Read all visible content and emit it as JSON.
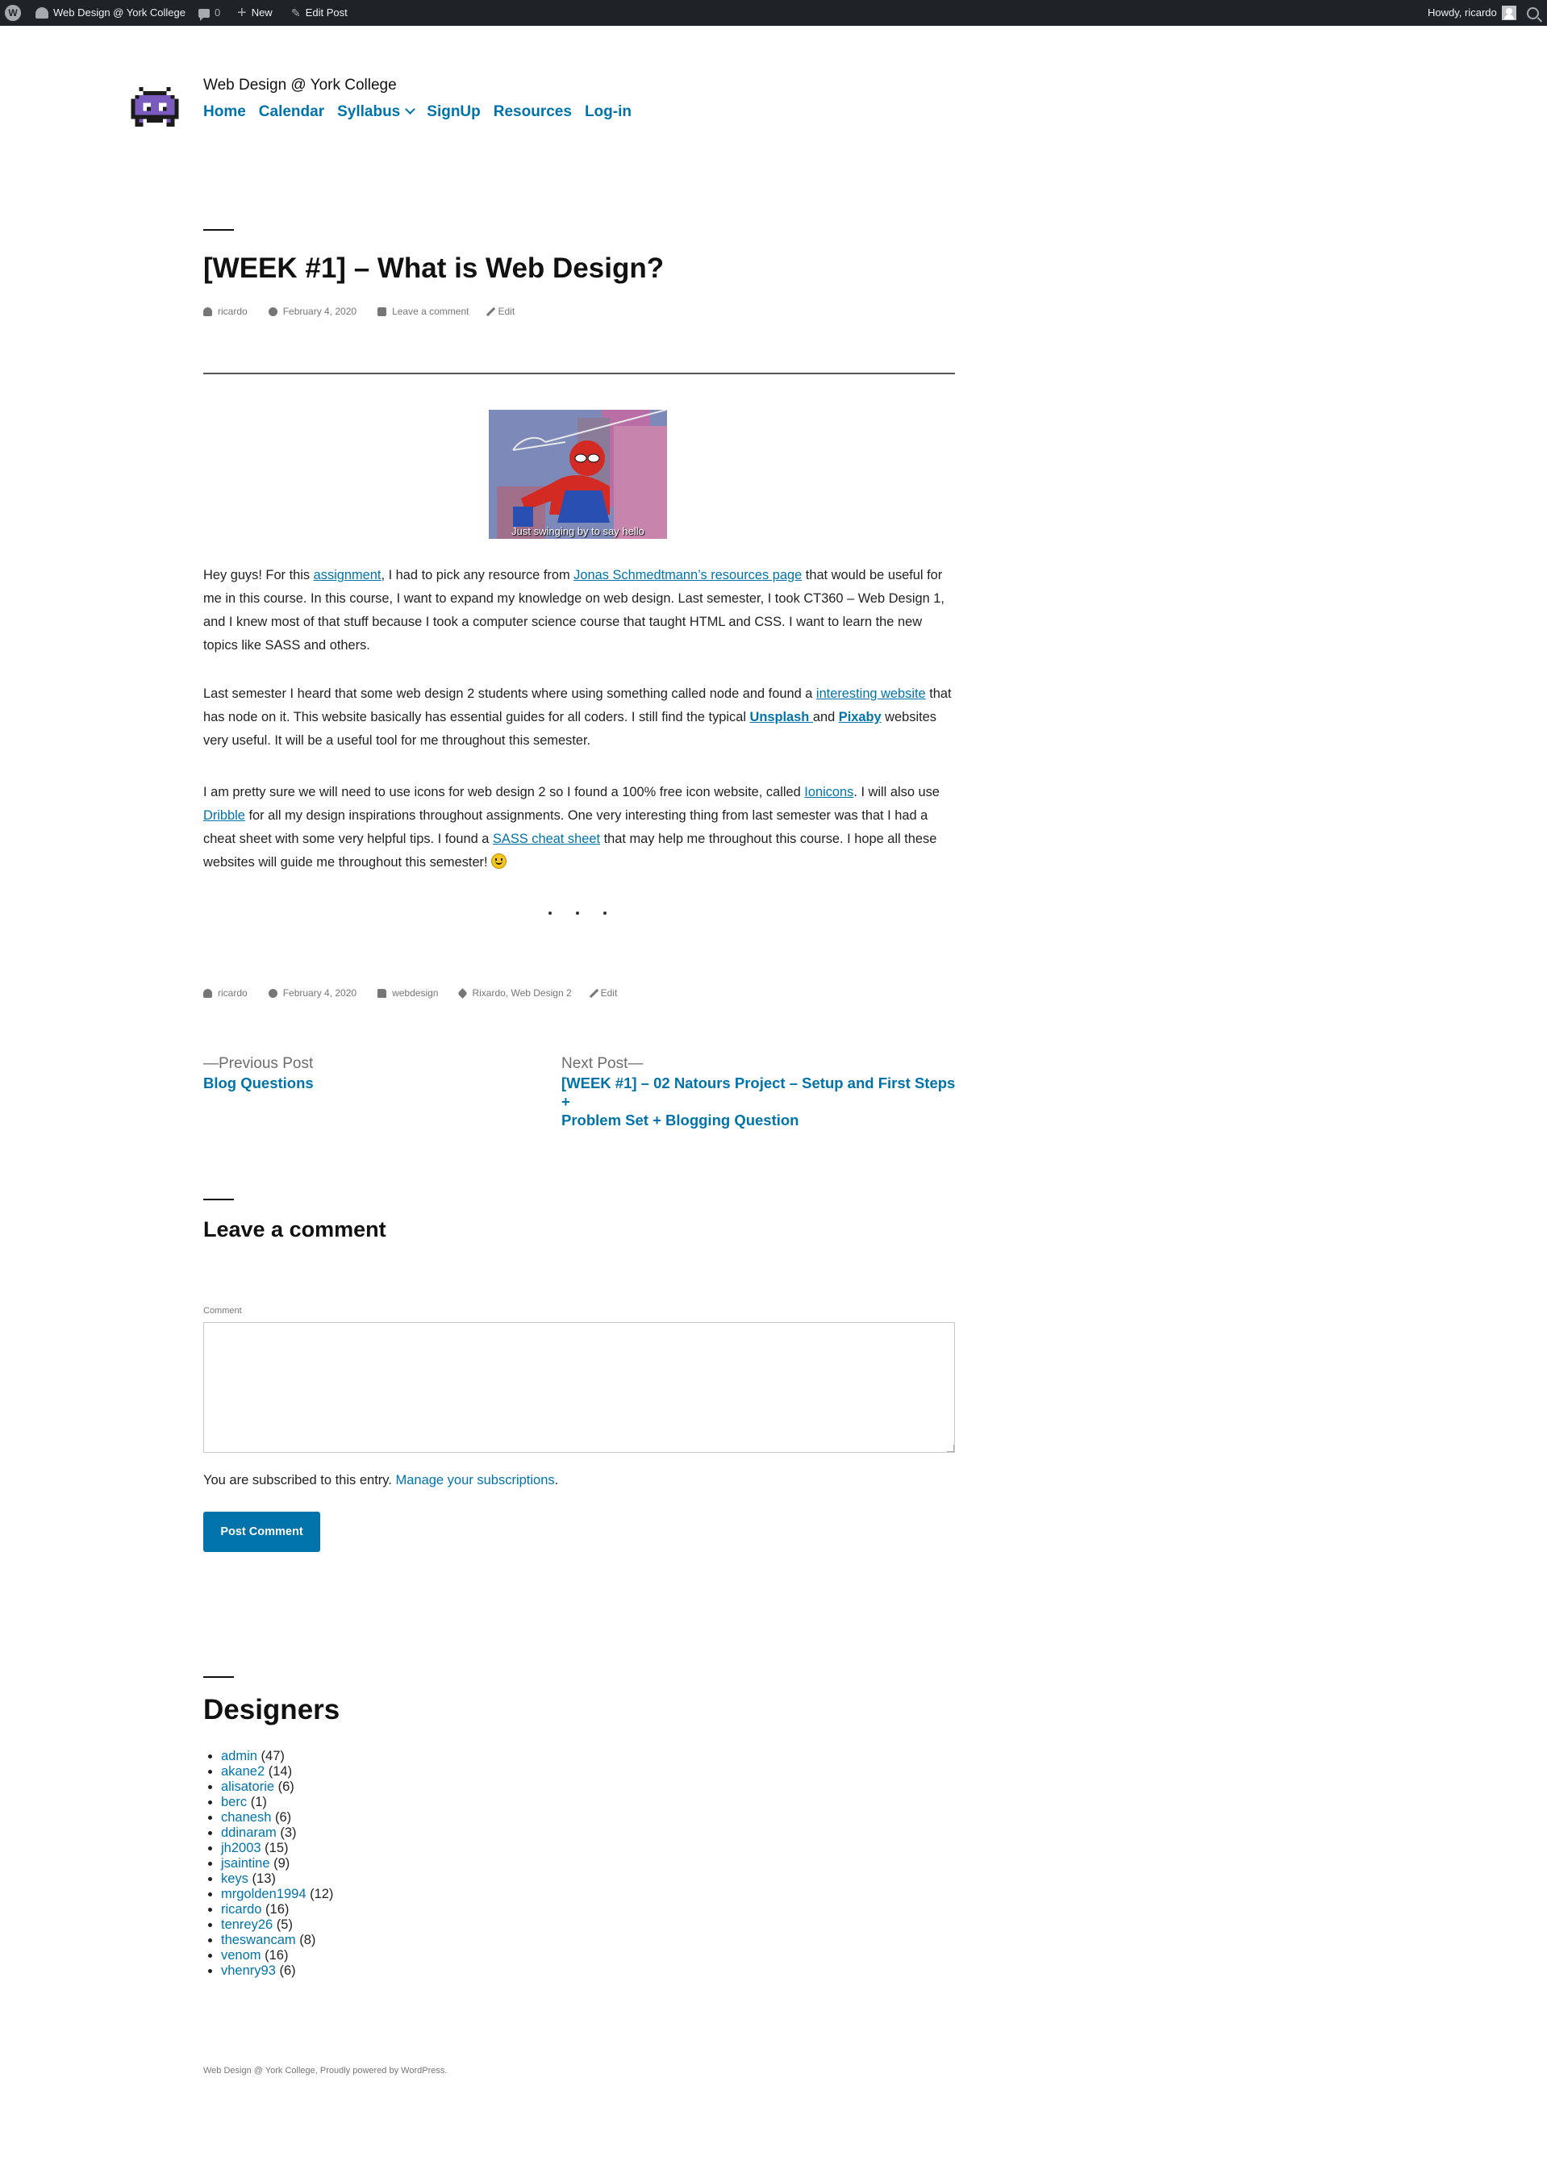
{
  "admin_bar": {
    "site_name": "Web Design @ York College",
    "comments_count": "0",
    "new_label": "New",
    "edit_post_label": "Edit Post",
    "howdy": "Howdy, ricardo"
  },
  "header": {
    "site_title": "Web Design @ York College",
    "nav": [
      "Home",
      "Calendar",
      "Syllabus",
      "SignUp",
      "Resources",
      "Log-in"
    ]
  },
  "post": {
    "title": "[WEEK #1] – What is Web Design?",
    "meta_top": {
      "author": "ricardo",
      "date": "February 4, 2020",
      "comment": "Leave a comment",
      "edit": "Edit"
    },
    "gif_caption": "Just swinging by to say hello",
    "p1": {
      "t1": "Hey guys! For this ",
      "l1": "assignment",
      "t2": ", I had to pick any resource from ",
      "l2": "Jonas Schmedtmann’s resources page",
      "t3": " that would be useful for me in this course. In this course, I want to expand my knowledge on web design. Last semester, I took CT360 – Web Design 1, and I knew most of that stuff because I took a computer science course that taught HTML and CSS. I want to learn the new topics like SASS and others."
    },
    "p2": {
      "t1": "Last semester I heard that some web design 2 students where using something called node and found a ",
      "l1": "interesting website",
      "t2": " that has node on it. This website basically has essential guides for all coders. I still find the typical ",
      "l2": "Unsplash ",
      "t3": "and ",
      "l3": "Pixaby",
      "t4": " websites very useful. It will be a useful tool for me throughout this semester."
    },
    "p3": {
      "t1": "I am pretty sure we will need to use icons for web design 2 so I found a 100% free icon website, called ",
      "l1": "Ionicons",
      "t2": ". I will also use ",
      "l2": "Dribble",
      "t3": " for all my design inspirations throughout assignments. One very interesting thing from last semester was that I had a cheat sheet with some very helpful tips. I found a ",
      "l3": "SASS cheat sheet",
      "t4": " that may help me throughout this course. I hope all these websites will guide me throughout this semester! "
    },
    "meta_bottom": {
      "author": "ricardo",
      "date": "February 4, 2020",
      "category": "webdesign",
      "tags": "Rixardo, Web Design 2",
      "edit": "Edit"
    }
  },
  "post_nav": {
    "prev_label": "—Previous Post",
    "prev_title": "Blog Questions",
    "next_label": "Next Post—",
    "next_title_line1": "[WEEK #1] – 02 Natours Project – Setup and First Steps +",
    "next_title_line2": "Problem Set + Blogging Question"
  },
  "comment_form": {
    "heading": "Leave a comment",
    "label": "Comment",
    "subscribed_text": "You are subscribed to this entry. ",
    "manage_link": "Manage your subscriptions",
    "period": ".",
    "submit": "Post Comment"
  },
  "designers": {
    "heading": "Designers",
    "items": [
      {
        "name": "admin",
        "count": " (47)"
      },
      {
        "name": "akane2",
        "count": " (14)"
      },
      {
        "name": "alisatorie",
        "count": " (6)"
      },
      {
        "name": "berc",
        "count": " (1)"
      },
      {
        "name": "chanesh",
        "count": " (6)"
      },
      {
        "name": "ddinaram",
        "count": " (3)"
      },
      {
        "name": "jh2003",
        "count": " (15)"
      },
      {
        "name": "jsaintine",
        "count": " (9)"
      },
      {
        "name": "keys",
        "count": " (13)"
      },
      {
        "name": "mrgolden1994",
        "count": " (12)"
      },
      {
        "name": "ricardo",
        "count": " (16)"
      },
      {
        "name": "tenrey26",
        "count": " (5)"
      },
      {
        "name": "theswancam",
        "count": " (8)"
      },
      {
        "name": "venom",
        "count": " (16)"
      },
      {
        "name": "vhenry93",
        "count": " (6)"
      }
    ]
  },
  "footer": {
    "text": "Web Design @ York College, Proudly powered by WordPress."
  },
  "colors": {
    "link": "#0073aa",
    "admin_bar": "#1d2327",
    "logo_purple": "#7a5cc0"
  }
}
